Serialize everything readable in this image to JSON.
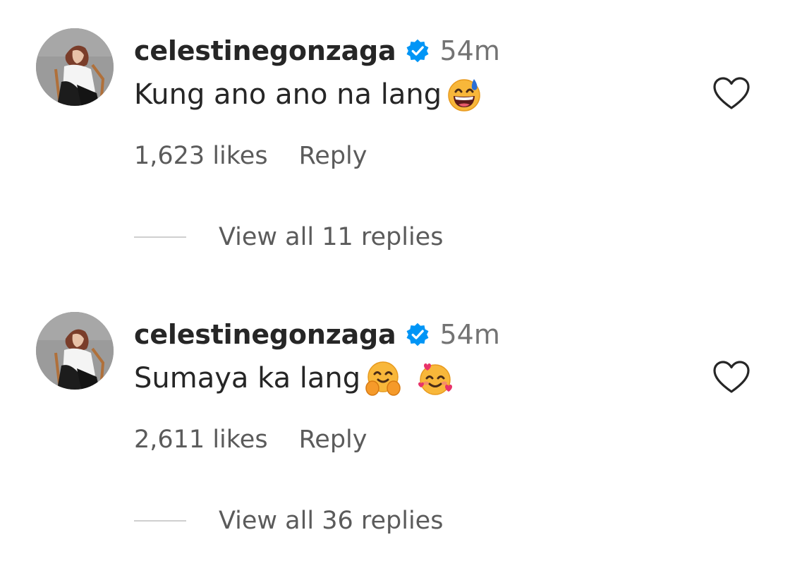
{
  "comments": [
    {
      "username": "celestinegonzaga",
      "time": "54m",
      "text": "Kung ano ano na lang",
      "emojis": [
        "grinning-sweat-emoji"
      ],
      "likes": "1,623 likes",
      "reply_label": "Reply",
      "view_replies": "View all 11 replies",
      "liked": false
    },
    {
      "username": "celestinegonzaga",
      "time": "54m",
      "text": "Sumaya ka lang",
      "emojis": [
        "hugging-face-emoji",
        "smiling-face-with-hearts-emoji"
      ],
      "likes": "2,611 likes",
      "reply_label": "Reply",
      "view_replies": "View all 36 replies",
      "liked": false
    }
  ],
  "colors": {
    "verified_badge": "#0095f6",
    "text": "#262626",
    "secondary_text": "#737373"
  },
  "icons": [
    "avatar-photo",
    "verified-badge-icon",
    "heart-outline-icon"
  ]
}
